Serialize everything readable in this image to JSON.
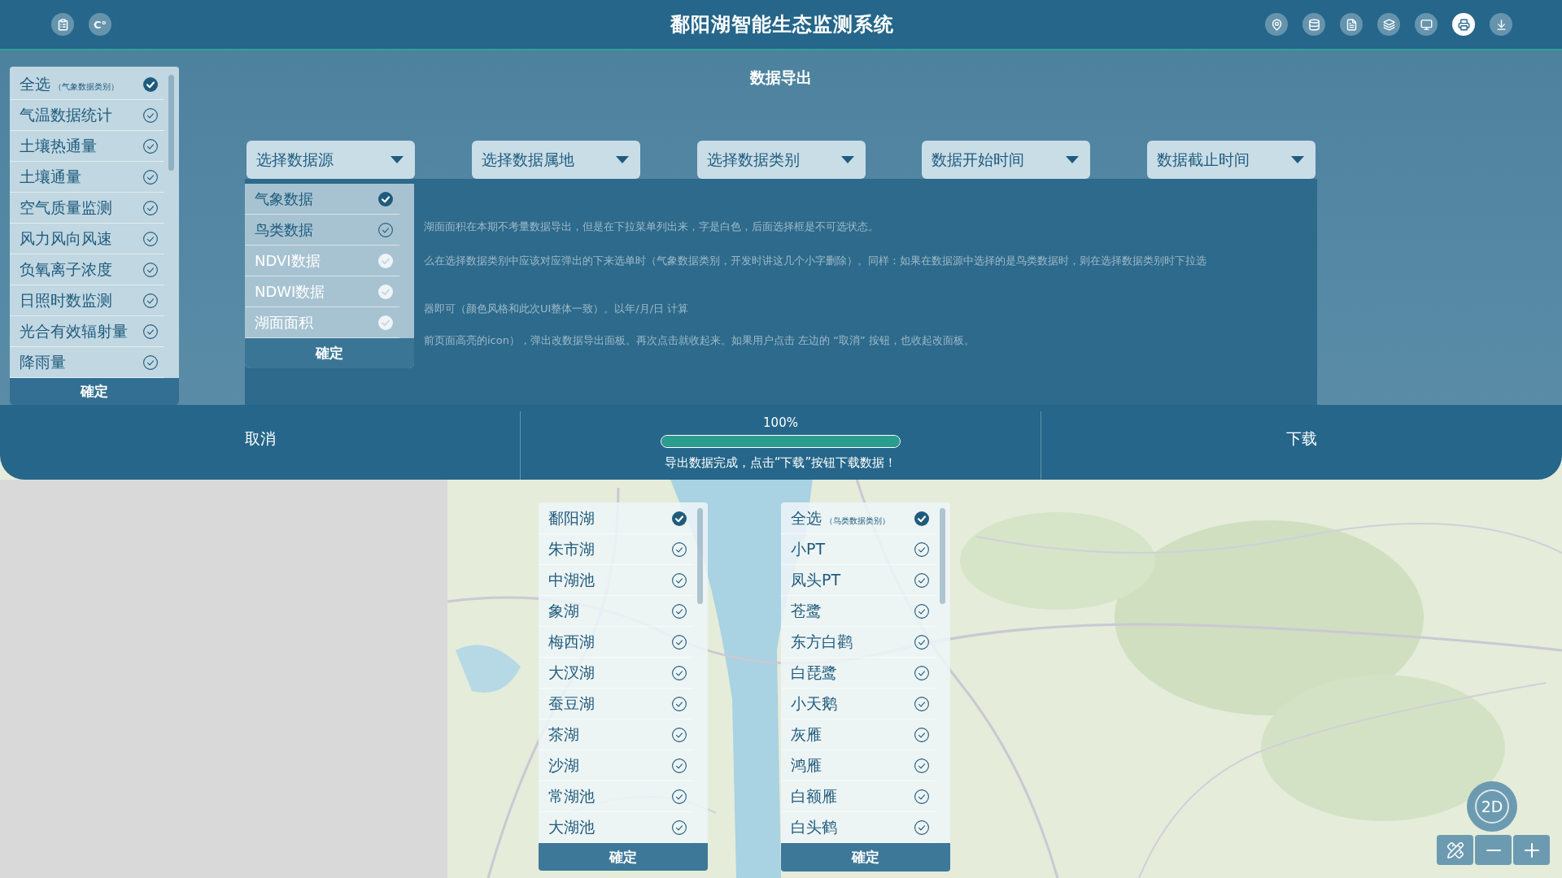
{
  "header": {
    "unit_button": "C°",
    "title": "鄱阳湖智能生态监测系统",
    "toolbar": [
      {
        "selected": false
      },
      {
        "selected": false
      },
      {
        "selected": false
      },
      {
        "selected": false
      },
      {
        "selected": false
      },
      {
        "selected": true
      },
      {
        "selected": false
      }
    ]
  },
  "weather_category_list": {
    "items": [
      {
        "label": "全选",
        "note": "（气象数据类别）",
        "checked": true
      },
      {
        "label": "气温数据统计",
        "checked": false
      },
      {
        "label": "土壤热通量",
        "checked": false
      },
      {
        "label": "土壤通量",
        "checked": false
      },
      {
        "label": "空气质量监测",
        "checked": false
      },
      {
        "label": "风力风向风速",
        "checked": false
      },
      {
        "label": "负氧离子浓度",
        "checked": false
      },
      {
        "label": "日照时数监测",
        "checked": false
      },
      {
        "label": "光合有效辐射量",
        "checked": false
      },
      {
        "label": "降雨量",
        "checked": false
      }
    ],
    "confirm": "確定"
  },
  "export_panel": {
    "title": "数据导出",
    "dropdowns": [
      {
        "label": "选择数据源",
        "options": [
          {
            "label": "气象数据",
            "checked": true,
            "disabled": false
          },
          {
            "label": "鸟类数据",
            "checked": false,
            "disabled": false
          },
          {
            "label": "NDVI数据",
            "checked": false,
            "disabled": true
          },
          {
            "label": "NDWI数据",
            "checked": false,
            "disabled": true
          },
          {
            "label": "湖面面积",
            "checked": false,
            "disabled": true
          }
        ],
        "confirm": "確定"
      },
      {
        "label": "选择数据属地"
      },
      {
        "label": "选择数据类别"
      },
      {
        "label": "数据开始时间"
      },
      {
        "label": "数据截止时间"
      }
    ],
    "notes": [
      "湖面面积在本期不考量数据导出，但是在下拉菜单列出来，字是白色，后面选择框是不可选状态。",
      "么在选择数据类别中应该对应弹出的下来选单时（气象数据类别，开发时讲这几个小字删除）。同样：如果在数据源中选择的是鸟类数据时，则在选择数据类别时下拉选",
      "器即可（颜色风格和此次UI整体一致）。以年/月/日 计算",
      "前页面高亮的icon），弹出改数据导出面板。再次点击就收起来。如果用户点击 左边的 “取消” 按钮，也收起改面板。"
    ]
  },
  "bottom_bar": {
    "cancel": "取消",
    "progress": {
      "reading": "100%",
      "level": 1,
      "message": "导出数据完成，点击“下载”按钮下载数据！"
    },
    "download": "下载"
  },
  "lake_list": {
    "items": [
      {
        "label": "鄱阳湖",
        "checked": true
      },
      {
        "label": "朱市湖",
        "checked": false
      },
      {
        "label": "中湖池",
        "checked": false
      },
      {
        "label": "象湖",
        "checked": false
      },
      {
        "label": "梅西湖",
        "checked": false
      },
      {
        "label": "大汊湖",
        "checked": false
      },
      {
        "label": "蚕豆湖",
        "checked": false
      },
      {
        "label": "茶湖",
        "checked": false
      },
      {
        "label": "沙湖",
        "checked": false
      },
      {
        "label": "常湖池",
        "checked": false
      },
      {
        "label": "大湖池",
        "checked": false
      }
    ],
    "confirm": "確定"
  },
  "bird_category_list": {
    "items": [
      {
        "label": "全选",
        "note": "（鸟类数据类别）",
        "checked": true
      },
      {
        "label": "小PT",
        "checked": false
      },
      {
        "label": "凤头PT",
        "checked": false
      },
      {
        "label": "苍鹭",
        "checked": false
      },
      {
        "label": "东方白鹳",
        "checked": false
      },
      {
        "label": "白琵鹭",
        "checked": false
      },
      {
        "label": "小天鹅",
        "checked": false
      },
      {
        "label": "灰雁",
        "checked": false
      },
      {
        "label": "鸿雁",
        "checked": false
      },
      {
        "label": "白额雁",
        "checked": false
      },
      {
        "label": "白头鹤",
        "checked": false
      }
    ],
    "confirm": "確定"
  },
  "map_controls": {
    "view_mode": "2D"
  }
}
